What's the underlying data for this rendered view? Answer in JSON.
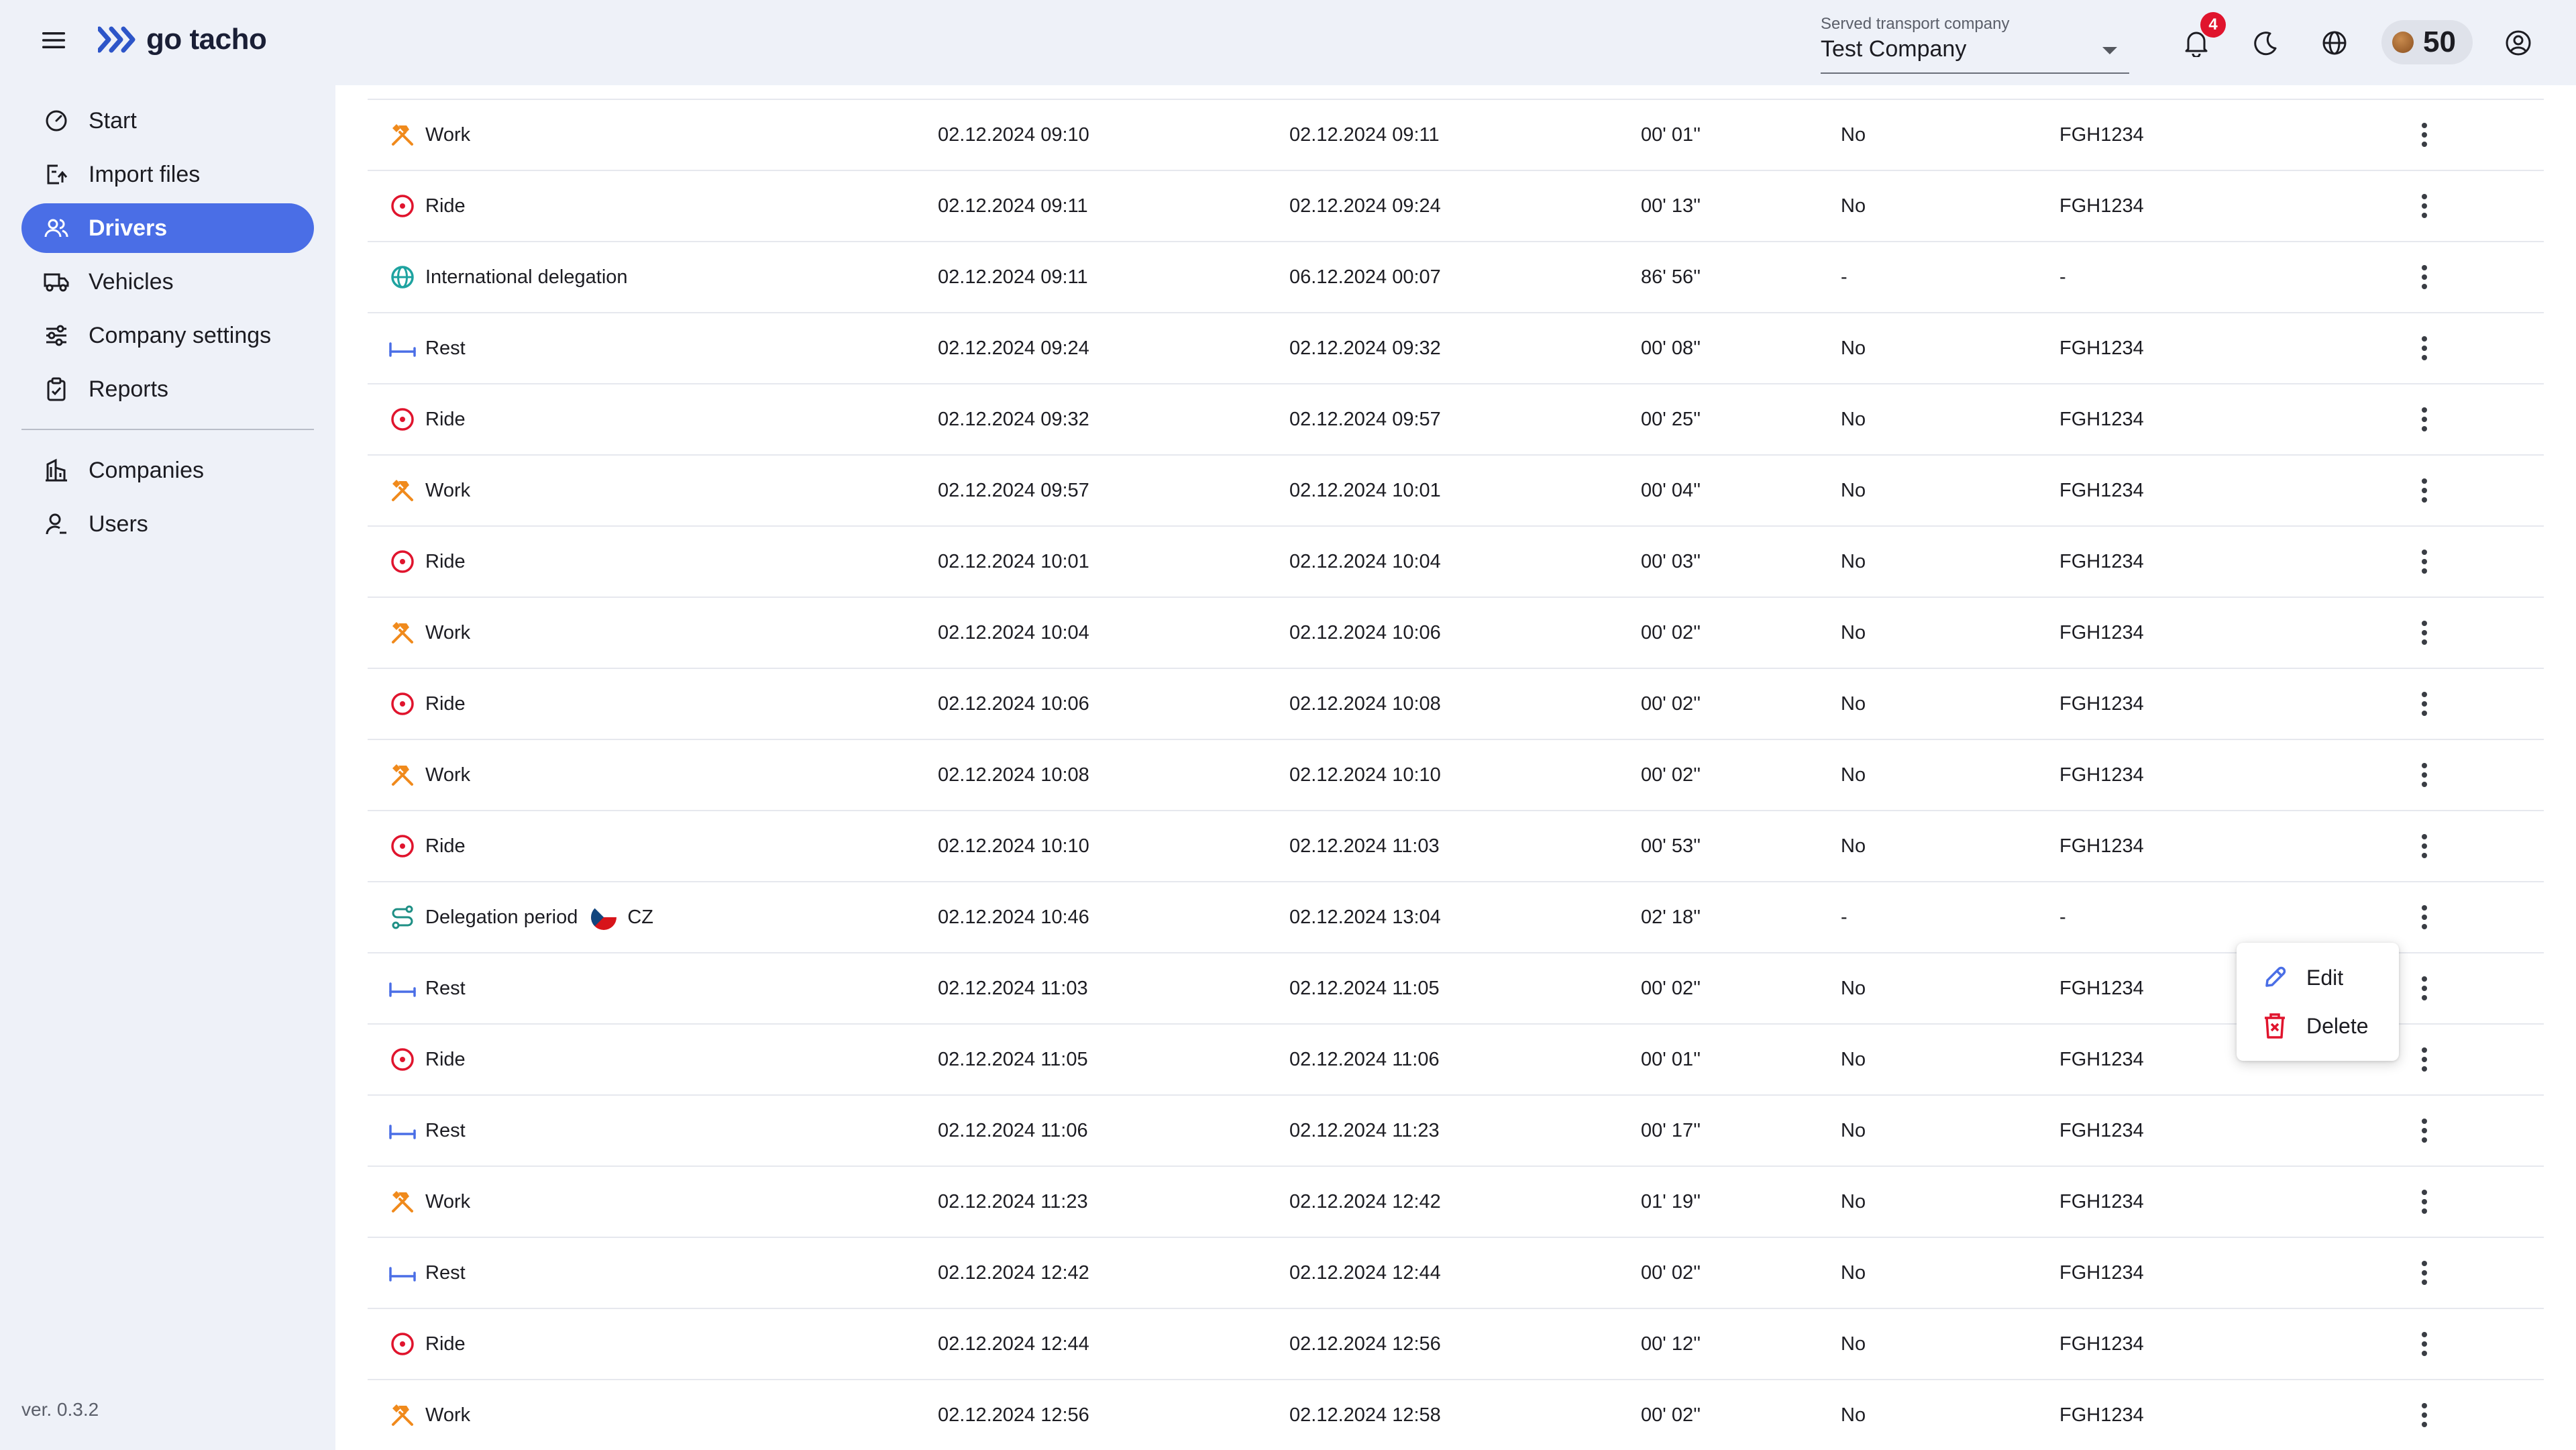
{
  "app": {
    "name": "go tacho",
    "version": "ver. 0.3.2"
  },
  "header": {
    "company_label": "Served transport company",
    "company_value": "Test Company",
    "notification_count": "4",
    "credits": "50"
  },
  "sidebar": {
    "items": [
      {
        "label": "Start",
        "icon": "gauge-icon"
      },
      {
        "label": "Import files",
        "icon": "import-icon"
      },
      {
        "label": "Drivers",
        "icon": "users-icon",
        "active": true
      },
      {
        "label": "Vehicles",
        "icon": "truck-icon"
      },
      {
        "label": "Company settings",
        "icon": "sliders-icon"
      },
      {
        "label": "Reports",
        "icon": "clipboard-icon"
      }
    ],
    "secondary": [
      {
        "label": "Companies",
        "icon": "building-icon"
      },
      {
        "label": "Users",
        "icon": "user-icon"
      }
    ]
  },
  "rows": [
    {
      "activity": "Work",
      "type": "work",
      "start": "02.12.2024 09:10",
      "end": "02.12.2024 09:11",
      "duration": "00' 01''",
      "manual": "No",
      "registration": "FGH1234"
    },
    {
      "activity": "Ride",
      "type": "ride",
      "start": "02.12.2024 09:11",
      "end": "02.12.2024 09:24",
      "duration": "00' 13''",
      "manual": "No",
      "registration": "FGH1234"
    },
    {
      "activity": "International delegation",
      "type": "intl",
      "start": "02.12.2024 09:11",
      "end": "06.12.2024 00:07",
      "duration": "86' 56''",
      "manual": "-",
      "registration": "-"
    },
    {
      "activity": "Rest",
      "type": "rest",
      "start": "02.12.2024 09:24",
      "end": "02.12.2024 09:32",
      "duration": "00' 08''",
      "manual": "No",
      "registration": "FGH1234"
    },
    {
      "activity": "Ride",
      "type": "ride",
      "start": "02.12.2024 09:32",
      "end": "02.12.2024 09:57",
      "duration": "00' 25''",
      "manual": "No",
      "registration": "FGH1234"
    },
    {
      "activity": "Work",
      "type": "work",
      "start": "02.12.2024 09:57",
      "end": "02.12.2024 10:01",
      "duration": "00' 04''",
      "manual": "No",
      "registration": "FGH1234"
    },
    {
      "activity": "Ride",
      "type": "ride",
      "start": "02.12.2024 10:01",
      "end": "02.12.2024 10:04",
      "duration": "00' 03''",
      "manual": "No",
      "registration": "FGH1234"
    },
    {
      "activity": "Work",
      "type": "work",
      "start": "02.12.2024 10:04",
      "end": "02.12.2024 10:06",
      "duration": "00' 02''",
      "manual": "No",
      "registration": "FGH1234"
    },
    {
      "activity": "Ride",
      "type": "ride",
      "start": "02.12.2024 10:06",
      "end": "02.12.2024 10:08",
      "duration": "00' 02''",
      "manual": "No",
      "registration": "FGH1234"
    },
    {
      "activity": "Work",
      "type": "work",
      "start": "02.12.2024 10:08",
      "end": "02.12.2024 10:10",
      "duration": "00' 02''",
      "manual": "No",
      "registration": "FGH1234"
    },
    {
      "activity": "Ride",
      "type": "ride",
      "start": "02.12.2024 10:10",
      "end": "02.12.2024 11:03",
      "duration": "00' 53''",
      "manual": "No",
      "registration": "FGH1234"
    },
    {
      "activity": "Delegation period",
      "type": "delegation",
      "country": "CZ",
      "start": "02.12.2024 10:46",
      "end": "02.12.2024 13:04",
      "duration": "02' 18''",
      "manual": "-",
      "registration": "-"
    },
    {
      "activity": "Rest",
      "type": "rest",
      "start": "02.12.2024 11:03",
      "end": "02.12.2024 11:05",
      "duration": "00' 02''",
      "manual": "No",
      "registration": "FGH1234"
    },
    {
      "activity": "Ride",
      "type": "ride",
      "start": "02.12.2024 11:05",
      "end": "02.12.2024 11:06",
      "duration": "00' 01''",
      "manual": "No",
      "registration": "FGH1234"
    },
    {
      "activity": "Rest",
      "type": "rest",
      "start": "02.12.2024 11:06",
      "end": "02.12.2024 11:23",
      "duration": "00' 17''",
      "manual": "No",
      "registration": "FGH1234"
    },
    {
      "activity": "Work",
      "type": "work",
      "start": "02.12.2024 11:23",
      "end": "02.12.2024 12:42",
      "duration": "01' 19''",
      "manual": "No",
      "registration": "FGH1234"
    },
    {
      "activity": "Rest",
      "type": "rest",
      "start": "02.12.2024 12:42",
      "end": "02.12.2024 12:44",
      "duration": "00' 02''",
      "manual": "No",
      "registration": "FGH1234"
    },
    {
      "activity": "Ride",
      "type": "ride",
      "start": "02.12.2024 12:44",
      "end": "02.12.2024 12:56",
      "duration": "00' 12''",
      "manual": "No",
      "registration": "FGH1234"
    },
    {
      "activity": "Work",
      "type": "work",
      "start": "02.12.2024 12:56",
      "end": "02.12.2024 12:58",
      "duration": "00' 02''",
      "manual": "No",
      "registration": "FGH1234"
    }
  ],
  "context_menu": {
    "edit": "Edit",
    "delete": "Delete"
  },
  "colors": {
    "accent": "#4a6ee6",
    "work": "#f08a1c",
    "ride": "#e0142d",
    "rest": "#4a6ee6",
    "intl": "#1ea3a0",
    "delegation": "#1e8f85"
  }
}
